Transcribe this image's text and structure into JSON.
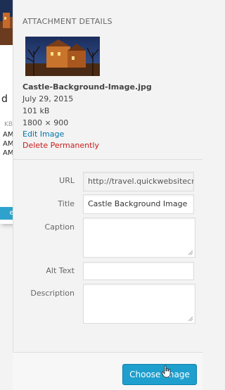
{
  "background_dialog": {
    "heading_fragment": "d",
    "size_fragment": "KB",
    "time_1": "AM",
    "time_2": "AM",
    "time_3": "AM",
    "button_fragment": "en"
  },
  "attachment": {
    "section_title": "ATTACHMENT DETAILS",
    "thumbnail_icon": "castle-thumbnail-image",
    "filename": "Castle-Background-Image.jpg",
    "date": "July 29, 2015",
    "filesize": "101 kB",
    "dimensions": "1800 × 900",
    "edit_link": "Edit Image",
    "delete_link": "Delete Permanently"
  },
  "fields": {
    "url_label": "URL",
    "url_value": "http://travel.quickwebsitecr",
    "title_label": "Title",
    "title_value": "Castle Background Image",
    "caption_label": "Caption",
    "caption_value": "",
    "alt_label": "Alt Text",
    "alt_value": "",
    "description_label": "Description",
    "description_value": ""
  },
  "footer": {
    "choose_button": "Choose Image"
  },
  "colors": {
    "primary": "#1f9fce",
    "link": "#0073aa",
    "danger": "#cc1b1b"
  }
}
